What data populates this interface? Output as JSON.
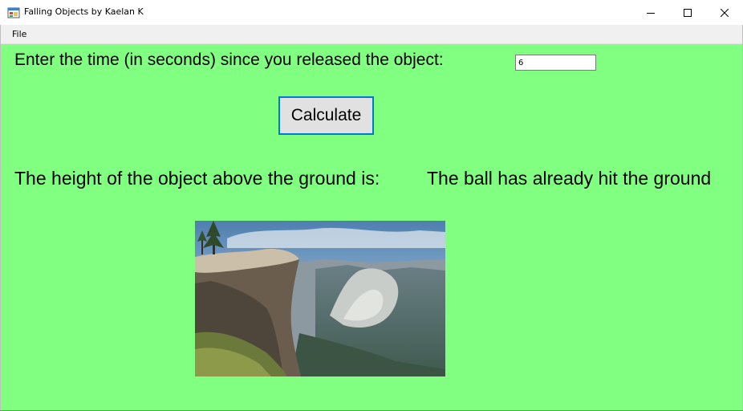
{
  "window": {
    "title": "Falling Objects by Kaelan K",
    "app_icon": "form-app-icon",
    "controls": [
      "minimize-icon",
      "maximize-icon",
      "close-icon"
    ]
  },
  "menu": {
    "items": [
      {
        "label": "File"
      }
    ]
  },
  "form": {
    "prompt": "Enter the time (in seconds) since you released the object:",
    "time_value": "6",
    "calculate_label": "Calculate",
    "height_label": "The height of the object above the ground is:",
    "result_text": "The ball has already hit the ground",
    "image": "cliff-valley-photo",
    "background_color": "#80ff80",
    "button_focus_color": "#0078d7"
  }
}
